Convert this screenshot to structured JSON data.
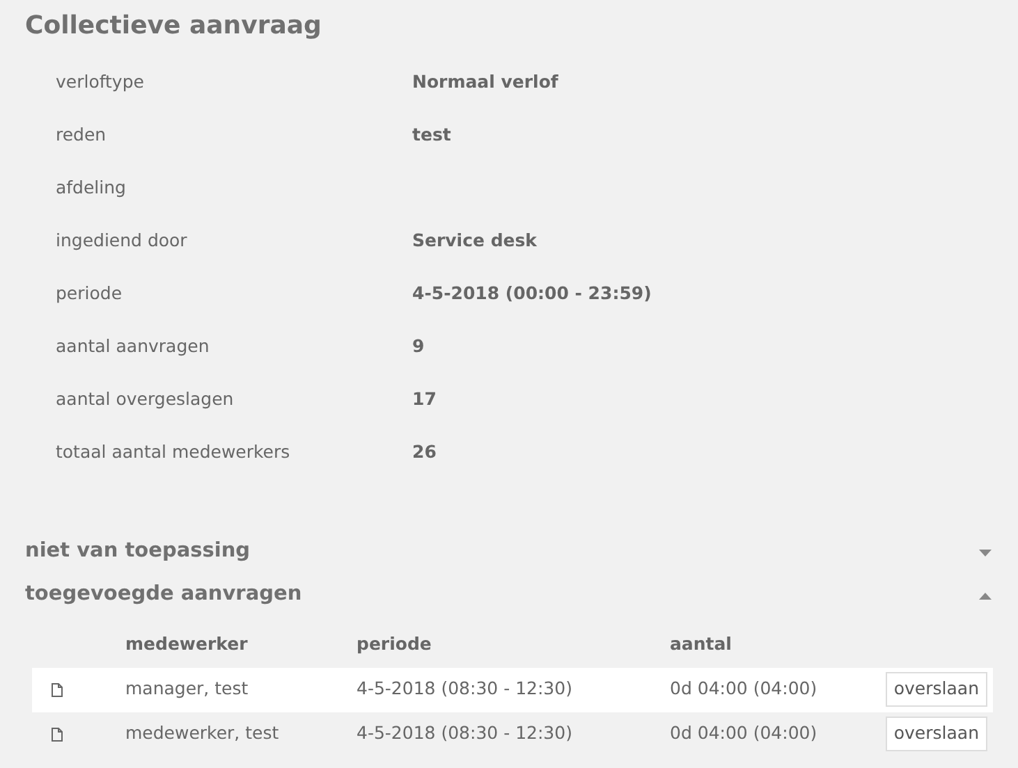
{
  "title": "Collectieve aanvraag",
  "details": [
    {
      "label": "verloftype",
      "value": "Normaal verlof"
    },
    {
      "label": "reden",
      "value": "test"
    },
    {
      "label": "afdeling"
    },
    {
      "label": "ingediend door",
      "value": "Service desk"
    },
    {
      "label": "periode",
      "value": "4-5-2018 (00:00 - 23:59)"
    },
    {
      "label": "aantal aanvragen",
      "value": "9"
    },
    {
      "label": "aantal overgeslagen",
      "value": "17"
    },
    {
      "label": "totaal aantal medewerkers",
      "value": "26"
    }
  ],
  "sections": [
    {
      "title": "niet van toepassing",
      "expanded": false
    },
    {
      "title": "toegevoegde aanvragen",
      "expanded": true
    }
  ],
  "table": {
    "columns": [
      "medewerker",
      "periode",
      "aantal"
    ],
    "rows": [
      {
        "cells": [
          "manager, test",
          "4-5-2018 (08:30 - 12:30)",
          "0d 04:00 (04:00)"
        ],
        "action": "overslaan"
      },
      {
        "cells": [
          "medewerker, test",
          "4-5-2018 (08:30 - 12:30)",
          "0d 04:00 (04:00)"
        ],
        "action": "overslaan"
      }
    ]
  }
}
